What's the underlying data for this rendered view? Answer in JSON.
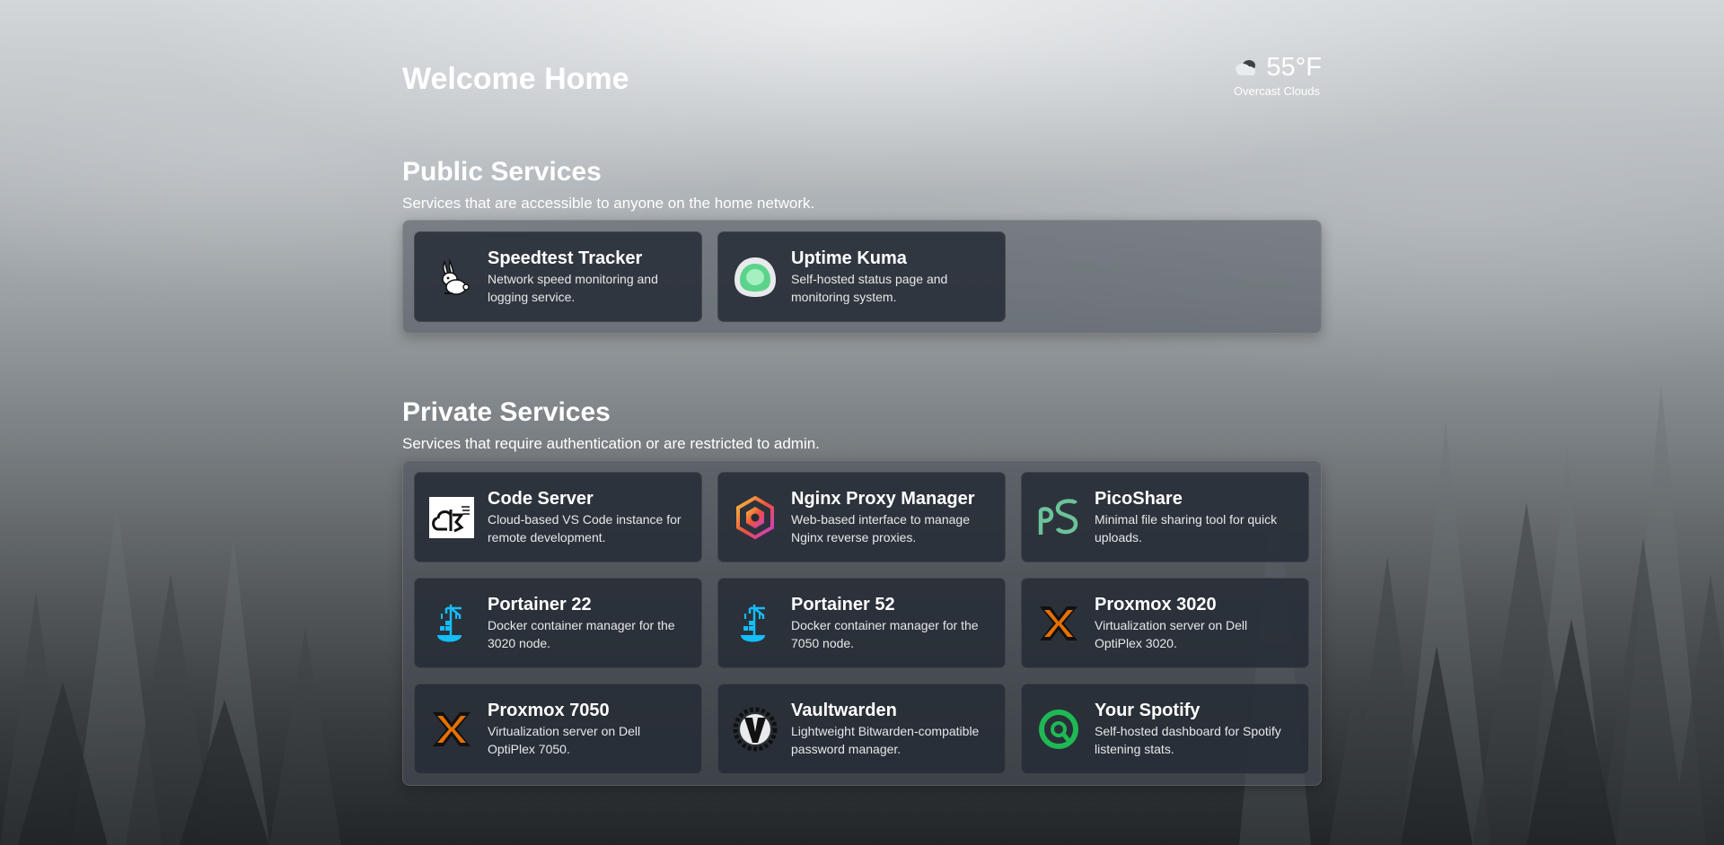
{
  "header": {
    "title": "Welcome Home",
    "weather": {
      "temperature": "55°F",
      "condition": "Overcast Clouds",
      "icon": "cloud-icon"
    }
  },
  "public": {
    "title": "Public Services",
    "description": "Services that are accessible to anyone on the home network.",
    "services": [
      {
        "name": "Speedtest Tracker",
        "description": "Network speed monitoring and logging service.",
        "icon": "rabbit-icon"
      },
      {
        "name": "Uptime Kuma",
        "description": "Self-hosted status page and monitoring system.",
        "icon": "uptime-kuma-icon"
      }
    ]
  },
  "private": {
    "title": "Private Services",
    "description": "Services that require authentication or are restricted to admin.",
    "services": [
      {
        "name": "Code Server",
        "description": "Cloud-based VS Code instance for remote development.",
        "icon": "code-server-icon"
      },
      {
        "name": "Nginx Proxy Manager",
        "description": "Web-based interface to manage Nginx reverse proxies.",
        "icon": "nginx-proxy-manager-icon"
      },
      {
        "name": "PicoShare",
        "description": "Minimal file sharing tool for quick uploads.",
        "icon": "picoshare-icon"
      },
      {
        "name": "Portainer 22",
        "description": "Docker container manager for the 3020 node.",
        "icon": "portainer-icon"
      },
      {
        "name": "Portainer 52",
        "description": "Docker container manager for the 7050 node.",
        "icon": "portainer-icon"
      },
      {
        "name": "Proxmox 3020",
        "description": "Virtualization server on Dell OptiPlex 3020.",
        "icon": "proxmox-icon"
      },
      {
        "name": "Proxmox 7050",
        "description": "Virtualization server on Dell OptiPlex 7050.",
        "icon": "proxmox-icon"
      },
      {
        "name": "Vaultwarden",
        "description": "Lightweight Bitwarden-compatible password manager.",
        "icon": "vaultwarden-icon"
      },
      {
        "name": "Your Spotify",
        "description": "Self-hosted dashboard for Spotify listening stats.",
        "icon": "spotify-stats-icon"
      }
    ]
  }
}
